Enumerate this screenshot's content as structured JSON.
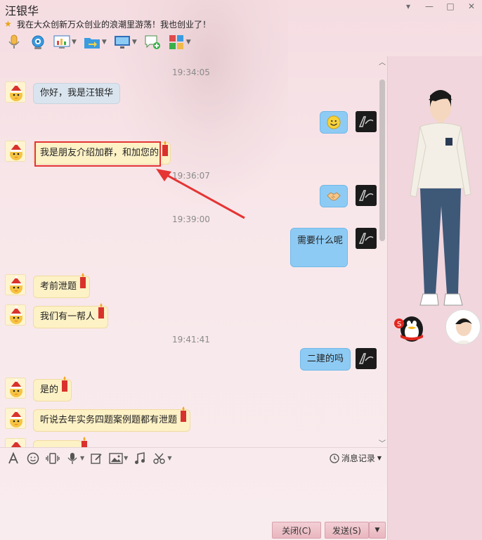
{
  "window": {
    "title": "汪银华",
    "signature": "我在大众创新万众创业的浪潮里游荡！我也创业了！"
  },
  "window_buttons": {
    "menu": "▾",
    "minimize": "—",
    "maximize": "□",
    "close": "✕"
  },
  "messages": {
    "ts1": "19:34:05",
    "m1": "你好，我是汪银华",
    "m2_icon": "smile-emoji",
    "m3": "我是朋友介绍加群，和加您的",
    "ts2": "19:36:07",
    "m4_icon": "handshake-emoji",
    "ts3": "19:39:00",
    "m5": "需要什么呢",
    "m6": "考前泄题",
    "m7": "我们有一帮人",
    "ts4": "19:41:41",
    "m8": "二建的吗",
    "m9": "是的",
    "m10": "听说去年实务四题案例题都有泄题"
  },
  "input": {
    "history_label": "消息记录",
    "close_label": "关闭(C)",
    "send_label": "发送(S)"
  },
  "colors": {
    "right_bubble": "#8ecbf4",
    "left_bubble": "#fdf1c6",
    "annotation": "#e53434"
  }
}
